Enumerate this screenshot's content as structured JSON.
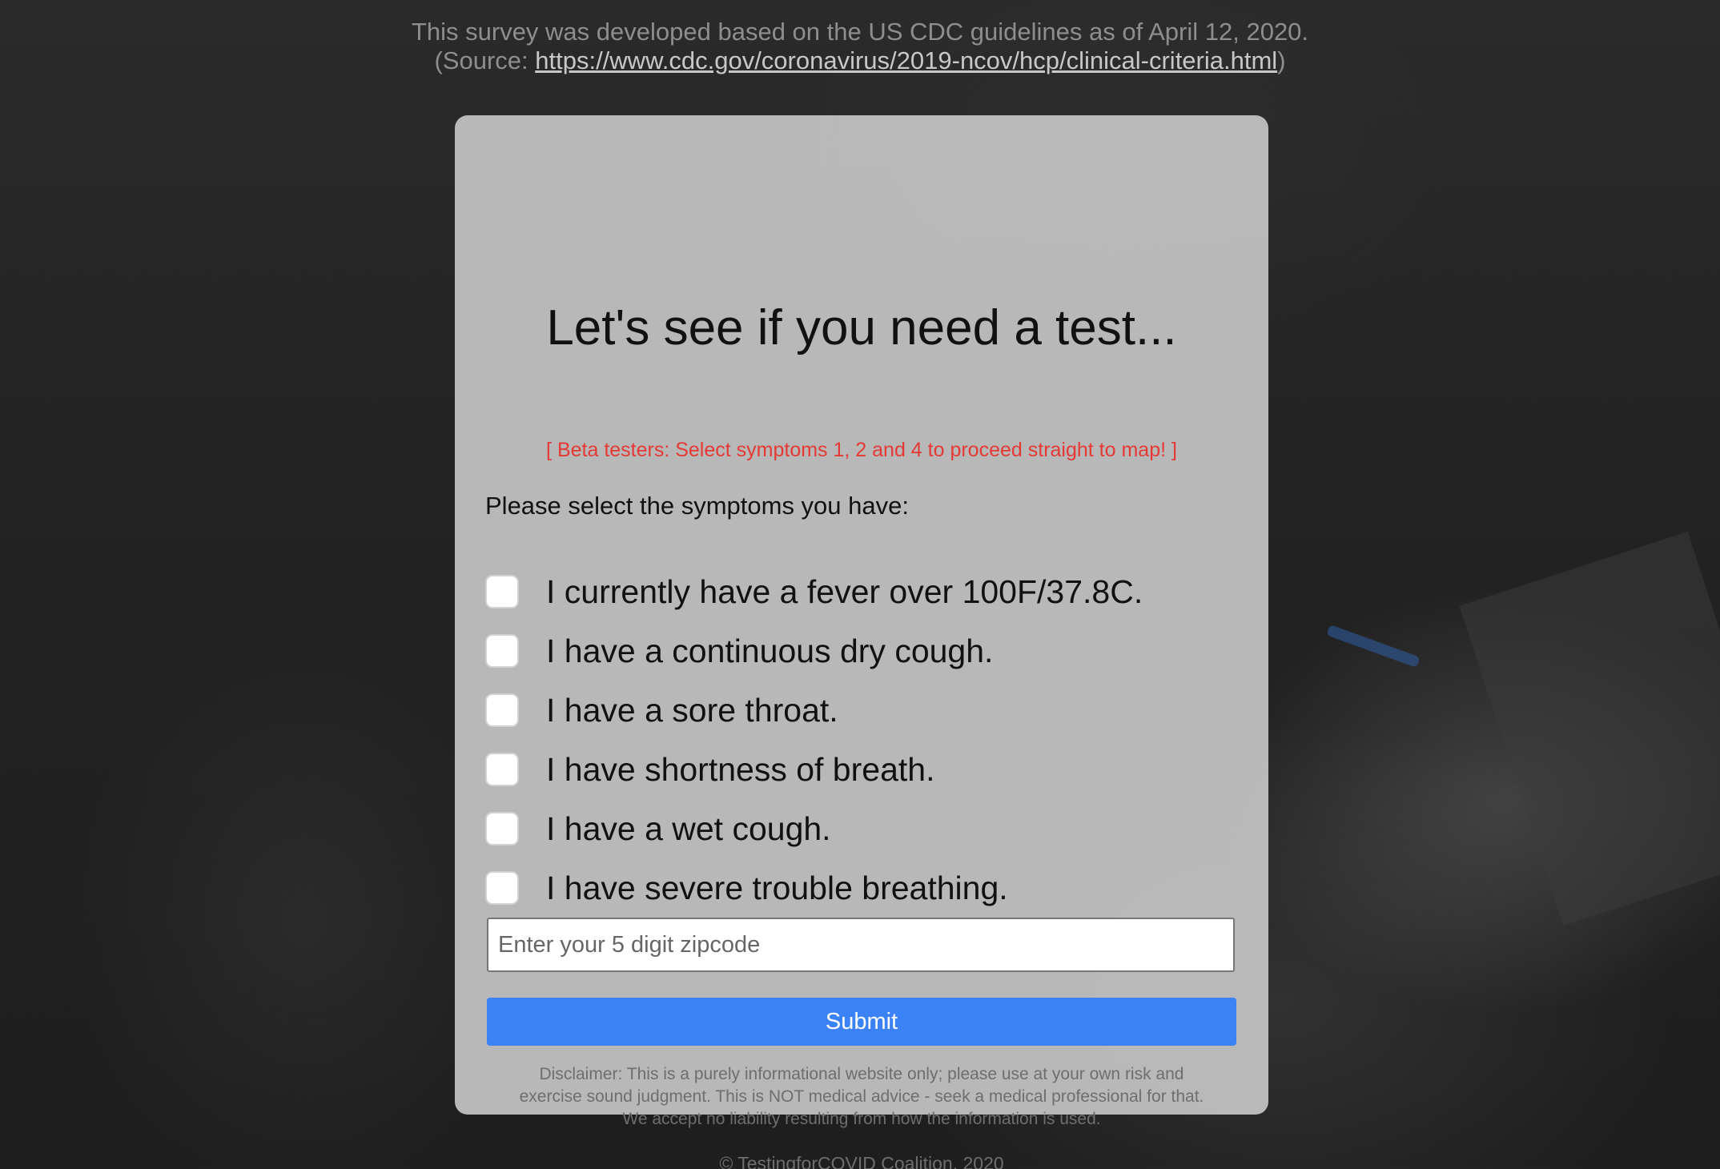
{
  "header": {
    "survey_note": "This survey was developed based on the US CDC guidelines as of April 12, 2020.",
    "source_prefix": "(Source: ",
    "source_link": "https://www.cdc.gov/coronavirus/2019-ncov/hcp/clinical-criteria.html",
    "source_suffix": ")"
  },
  "card": {
    "title": "Let's see if you need a test...",
    "beta_note": "[ Beta testers: Select symptoms 1, 2 and 4 to proceed straight to map! ]",
    "prompt": "Please select the symptoms you have:",
    "symptoms": [
      {
        "label": "I currently have a fever over 100F/37.8C.",
        "checked": false
      },
      {
        "label": "I have a continuous dry cough.",
        "checked": false
      },
      {
        "label": "I have a sore throat.",
        "checked": false
      },
      {
        "label": "I have shortness of breath.",
        "checked": false
      },
      {
        "label": "I have a wet cough.",
        "checked": false
      },
      {
        "label": "I have severe trouble breathing.",
        "checked": false
      }
    ],
    "zip": {
      "placeholder": "Enter your 5 digit zipcode",
      "value": ""
    },
    "submit_label": "Submit",
    "disclaimer_lines": [
      "Disclaimer: This is a purely informational website only; please use at your own risk and",
      "exercise sound judgment. This is NOT medical advice - seek a medical professional for that.",
      "We accept no liability resulting from how the information is used."
    ],
    "copyright": "© TestingforCOVID Coalition, 2020"
  },
  "colors": {
    "accent": "#3b82f6",
    "beta_note": "#e53935",
    "card_bg": "#c4c4c4"
  }
}
